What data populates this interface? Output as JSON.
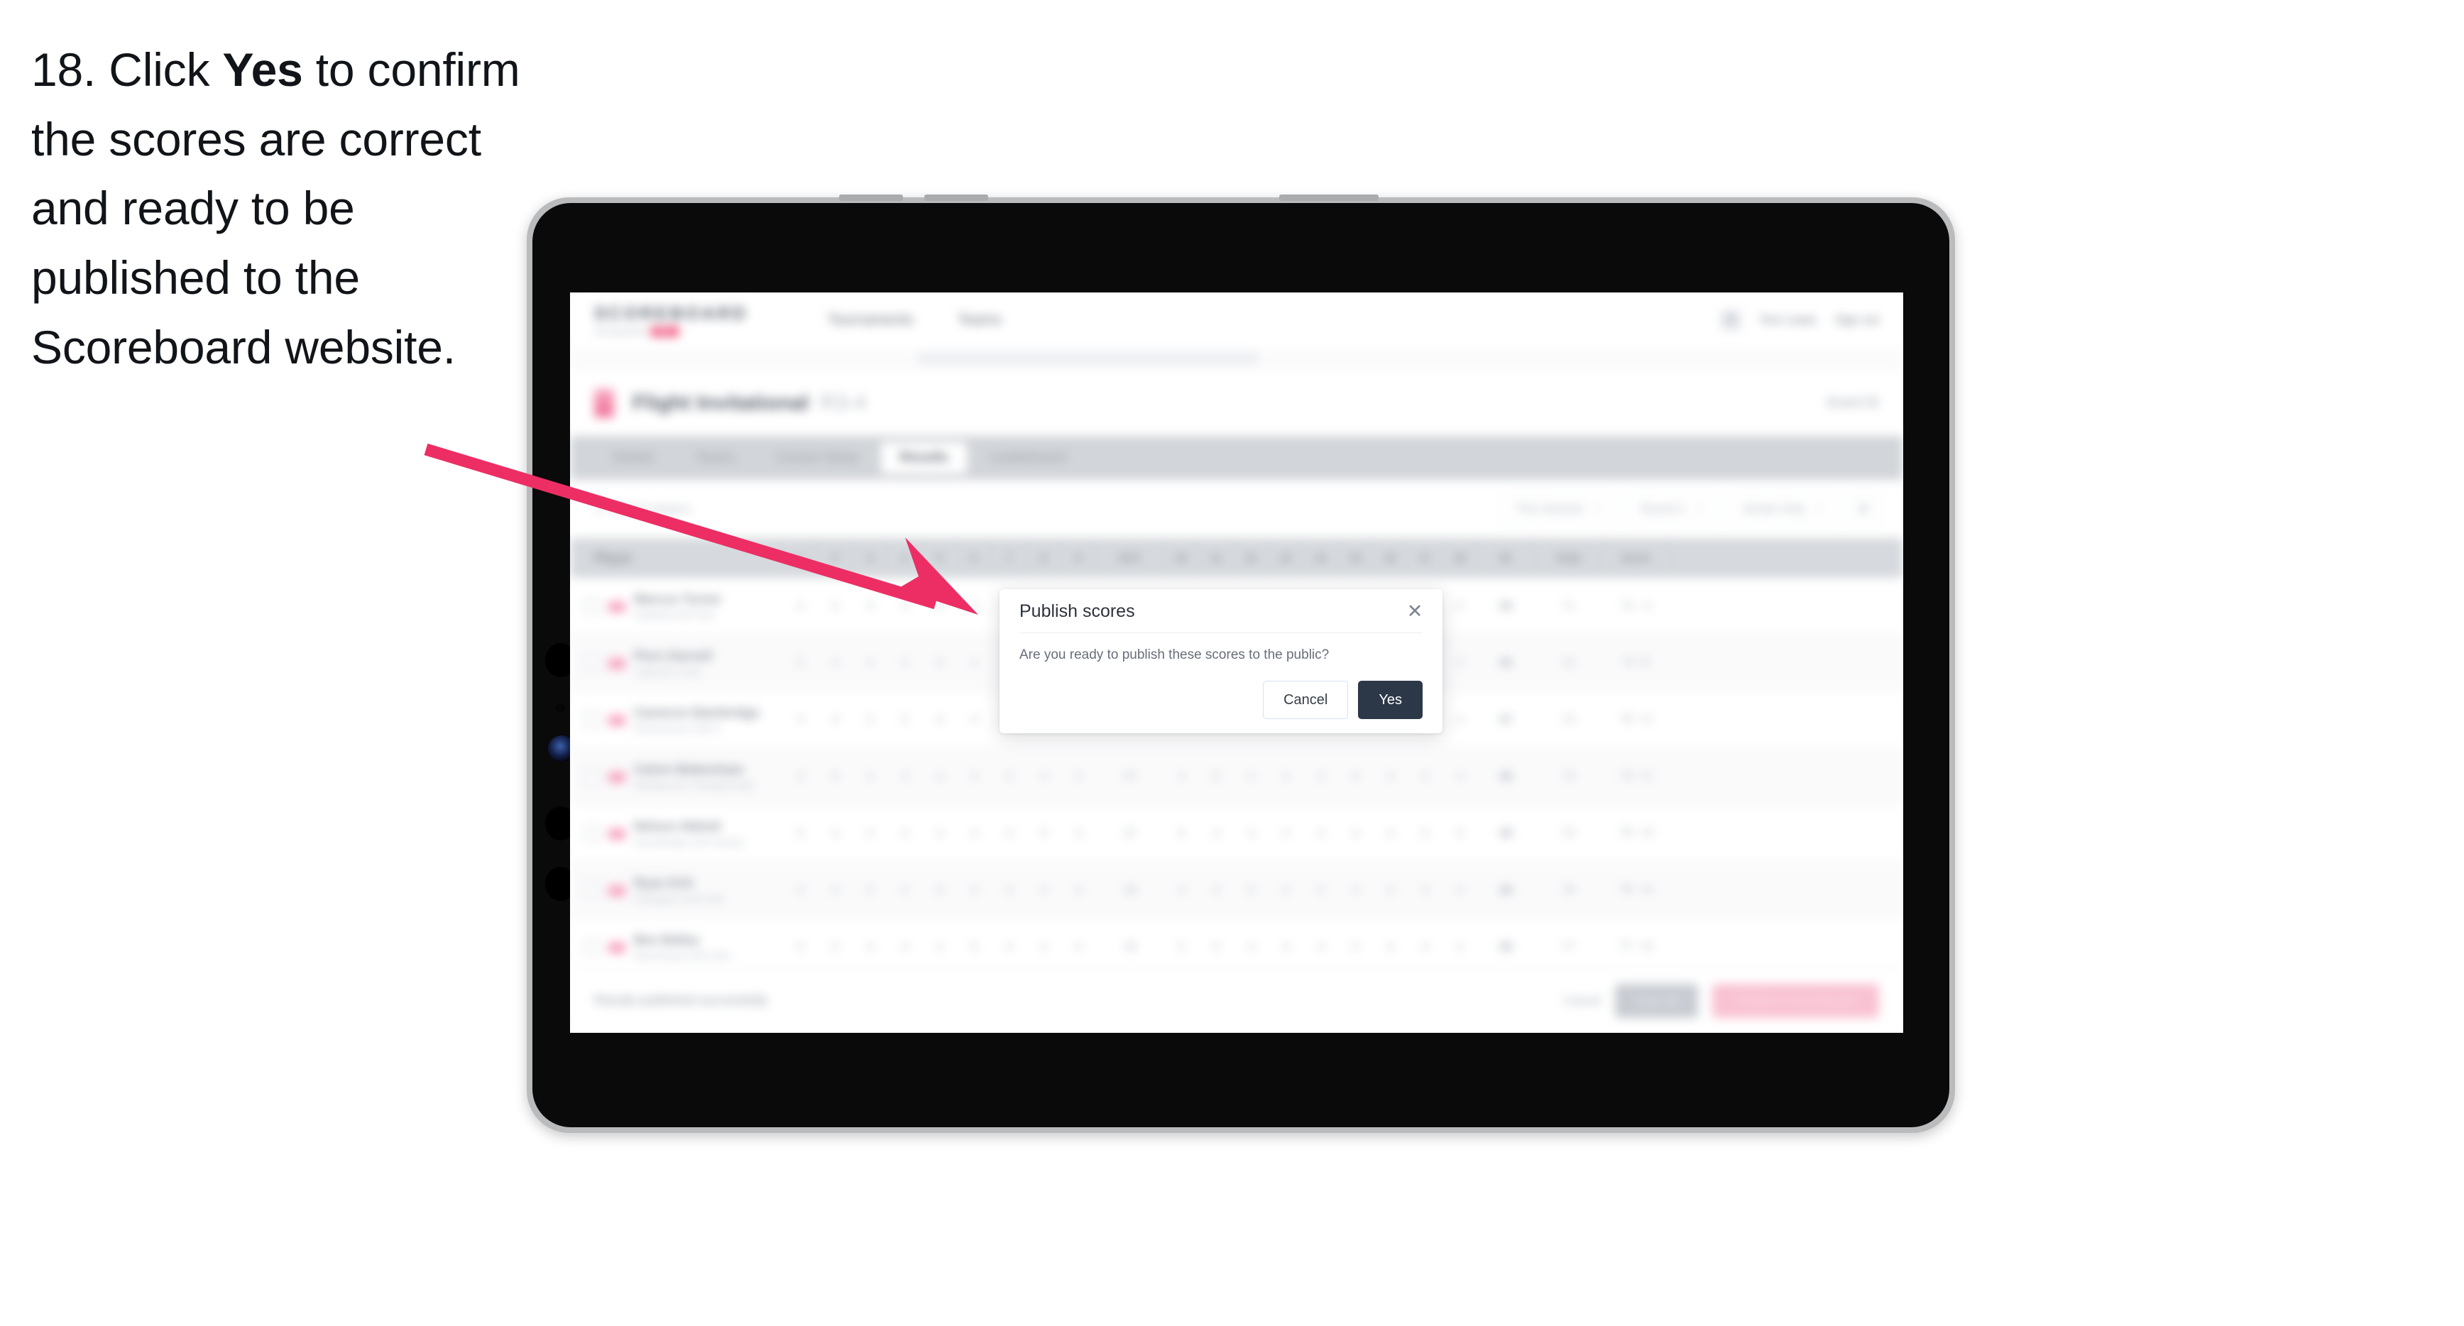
{
  "instruction": {
    "number": "18.",
    "part1": "Click ",
    "emphasis": "Yes",
    "part2": " to confirm the scores are correct and ready to be published to the Scoreboard website."
  },
  "annotation": {
    "arrow_color": "#ec2e64",
    "arrow_from": "600,633",
    "arrow_to": "1378,866"
  },
  "device": {
    "type": "tablet",
    "bezel_color": "#b9bbbd",
    "frame_color": "#0a0a0a",
    "screen_color": "#fdfdfd"
  },
  "app": {
    "brand": {
      "wordmark": "SCOREBOARD",
      "subtitle": "Tournaments",
      "badge": "PRO"
    },
    "top_nav": [
      "Tournaments",
      "Teams"
    ],
    "header_right": {
      "user": "Tom Lewis",
      "signout": "Sign out"
    },
    "event": {
      "title": "Flight Invitational",
      "round": "R3-4",
      "right_label": "Event ID"
    },
    "tabs": [
      {
        "label": "Details",
        "active": false
      },
      {
        "label": "Teams",
        "active": false
      },
      {
        "label": "Course Setup",
        "active": false
      },
      {
        "label": "Results",
        "active": true
      },
      {
        "label": "Leaderboard",
        "active": false
      }
    ],
    "filters": {
      "search_placeholder": "Search players",
      "search_icon": "search-icon",
      "controls": [
        {
          "label": "This Session"
        },
        {
          "label": "Round 1"
        },
        {
          "label": "Stroke Only"
        }
      ],
      "icon_button": "settings-icon"
    },
    "table": {
      "headers": {
        "player": "Player",
        "holes": [
          "1",
          "2",
          "3",
          "4",
          "5",
          "6",
          "7",
          "8",
          "9",
          "OUT",
          "10",
          "11",
          "12",
          "13",
          "14",
          "15",
          "16",
          "17",
          "18",
          "IN"
        ],
        "total": "Total",
        "score": "Score"
      },
      "rows": [
        {
          "name": "Marcus Turner",
          "club": "Oakfield Golf Club",
          "holes": [
            "4",
            "5",
            "3",
            "4",
            "4",
            "5",
            "4",
            "3",
            "4"
          ],
          "out": "36",
          "in": "35",
          "total": "71",
          "score": "-1"
        },
        {
          "name": "Piers Darnell",
          "club": "Lakeview Links",
          "holes": [
            "5",
            "4",
            "4",
            "3",
            "5",
            "4",
            "4",
            "4",
            "3"
          ],
          "out": "36",
          "in": "36",
          "total": "72",
          "score": "E"
        },
        {
          "name": "Cameron Bainbridge",
          "club": "Ravenscourt G&CC",
          "holes": [
            "4",
            "4",
            "3",
            "5",
            "4",
            "4",
            "5",
            "3",
            "4"
          ],
          "out": "36",
          "in": "37",
          "total": "73",
          "score": "+1"
        },
        {
          "name": "Calvin Blakenham",
          "club": "Westbourne Championship",
          "holes": [
            "4",
            "5",
            "4",
            "4",
            "3",
            "5",
            "4",
            "4",
            "4"
          ],
          "out": "37",
          "in": "36",
          "total": "73",
          "score": "+1"
        },
        {
          "name": "Nelson Abbott",
          "club": "Stonebridge Golf Society",
          "holes": [
            "5",
            "4",
            "4",
            "4",
            "4",
            "4",
            "4",
            "5",
            "3"
          ],
          "out": "37",
          "in": "38",
          "total": "75",
          "score": "+3"
        },
        {
          "name": "Ryan Kirk",
          "club": "Harlington Park Golf",
          "holes": [
            "4",
            "4",
            "5",
            "4",
            "5",
            "4",
            "4",
            "4",
            "4"
          ],
          "out": "38",
          "in": "38",
          "total": "76",
          "score": "+4"
        },
        {
          "name": "Ben Bailey",
          "club": "Marchwood Golf Club",
          "holes": [
            "5",
            "5",
            "4",
            "4",
            "4",
            "5",
            "4",
            "4",
            "4"
          ],
          "out": "39",
          "in": "38",
          "total": "77",
          "score": "+5"
        }
      ]
    },
    "bottom_bar": {
      "note": "Results published successfully",
      "link": "Cancel",
      "secondary_button": "Save all",
      "primary_button": "Publish to Scoreboard"
    }
  },
  "modal": {
    "title": "Publish scores",
    "body": "Are you ready to publish these scores to the public?",
    "close_icon": "close-icon",
    "cancel_label": "Cancel",
    "confirm_label": "Yes",
    "confirm_color": "#2c3847"
  }
}
